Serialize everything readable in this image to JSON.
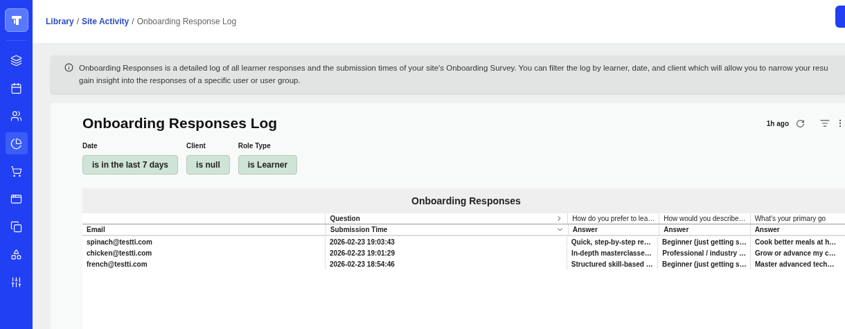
{
  "sidebar": {
    "items": [
      {
        "selected": false
      },
      {
        "selected": false
      },
      {
        "selected": false
      },
      {
        "selected": true
      },
      {
        "selected": false
      },
      {
        "selected": false
      },
      {
        "selected": false
      },
      {
        "selected": false
      },
      {
        "selected": false
      }
    ]
  },
  "breadcrumb": [
    {
      "label": "Library",
      "kind": "link"
    },
    {
      "label": "/",
      "kind": "separator"
    },
    {
      "label": "Site Activity",
      "kind": "link"
    },
    {
      "label": "/",
      "kind": "separator"
    },
    {
      "label": "Onboarding Response Log",
      "kind": "current"
    }
  ],
  "info_banner": {
    "lines": [
      "Onboarding Responses is a detailed log of all learner responses and the submission times of your site's Onboarding Survey. You can filter the log by learner, date, and client which will allow you to narrow your resu",
      "gain insight into the responses of a specific user or user group."
    ]
  },
  "report": {
    "title": "Onboarding Responses Log",
    "updated": "1h ago",
    "filters": [
      {
        "label": "Date",
        "value": "is in the last 7 days"
      },
      {
        "label": "Client",
        "value": "is null"
      },
      {
        "label": "Role Type",
        "value": "is Learner"
      }
    ],
    "table": {
      "title": "Onboarding Responses",
      "pivot_label": "Question",
      "questions": [
        "How do you prefer to lea…",
        "How would you describe…",
        "What's your primary go"
      ],
      "columns": [
        "Email",
        "Submission Time",
        "Answer",
        "Answer",
        "Answer"
      ],
      "rows": [
        [
          "spinach@testti.com",
          "2026-02-23 19:03:43",
          "Quick, step-by-step re…",
          "Beginner (just getting s…",
          "Cook better meals at h…"
        ],
        [
          "chicken@testti.com",
          "2026-02-23 19:01:29",
          "In-depth masterclasse…",
          "Professional / industry …",
          "Grow or advance my c…"
        ],
        [
          "french@testti.com",
          "2026-02-23 18:54:46",
          "Structured skill-based …",
          "Beginner (just getting s…",
          "Master advanced tech…"
        ]
      ]
    }
  }
}
